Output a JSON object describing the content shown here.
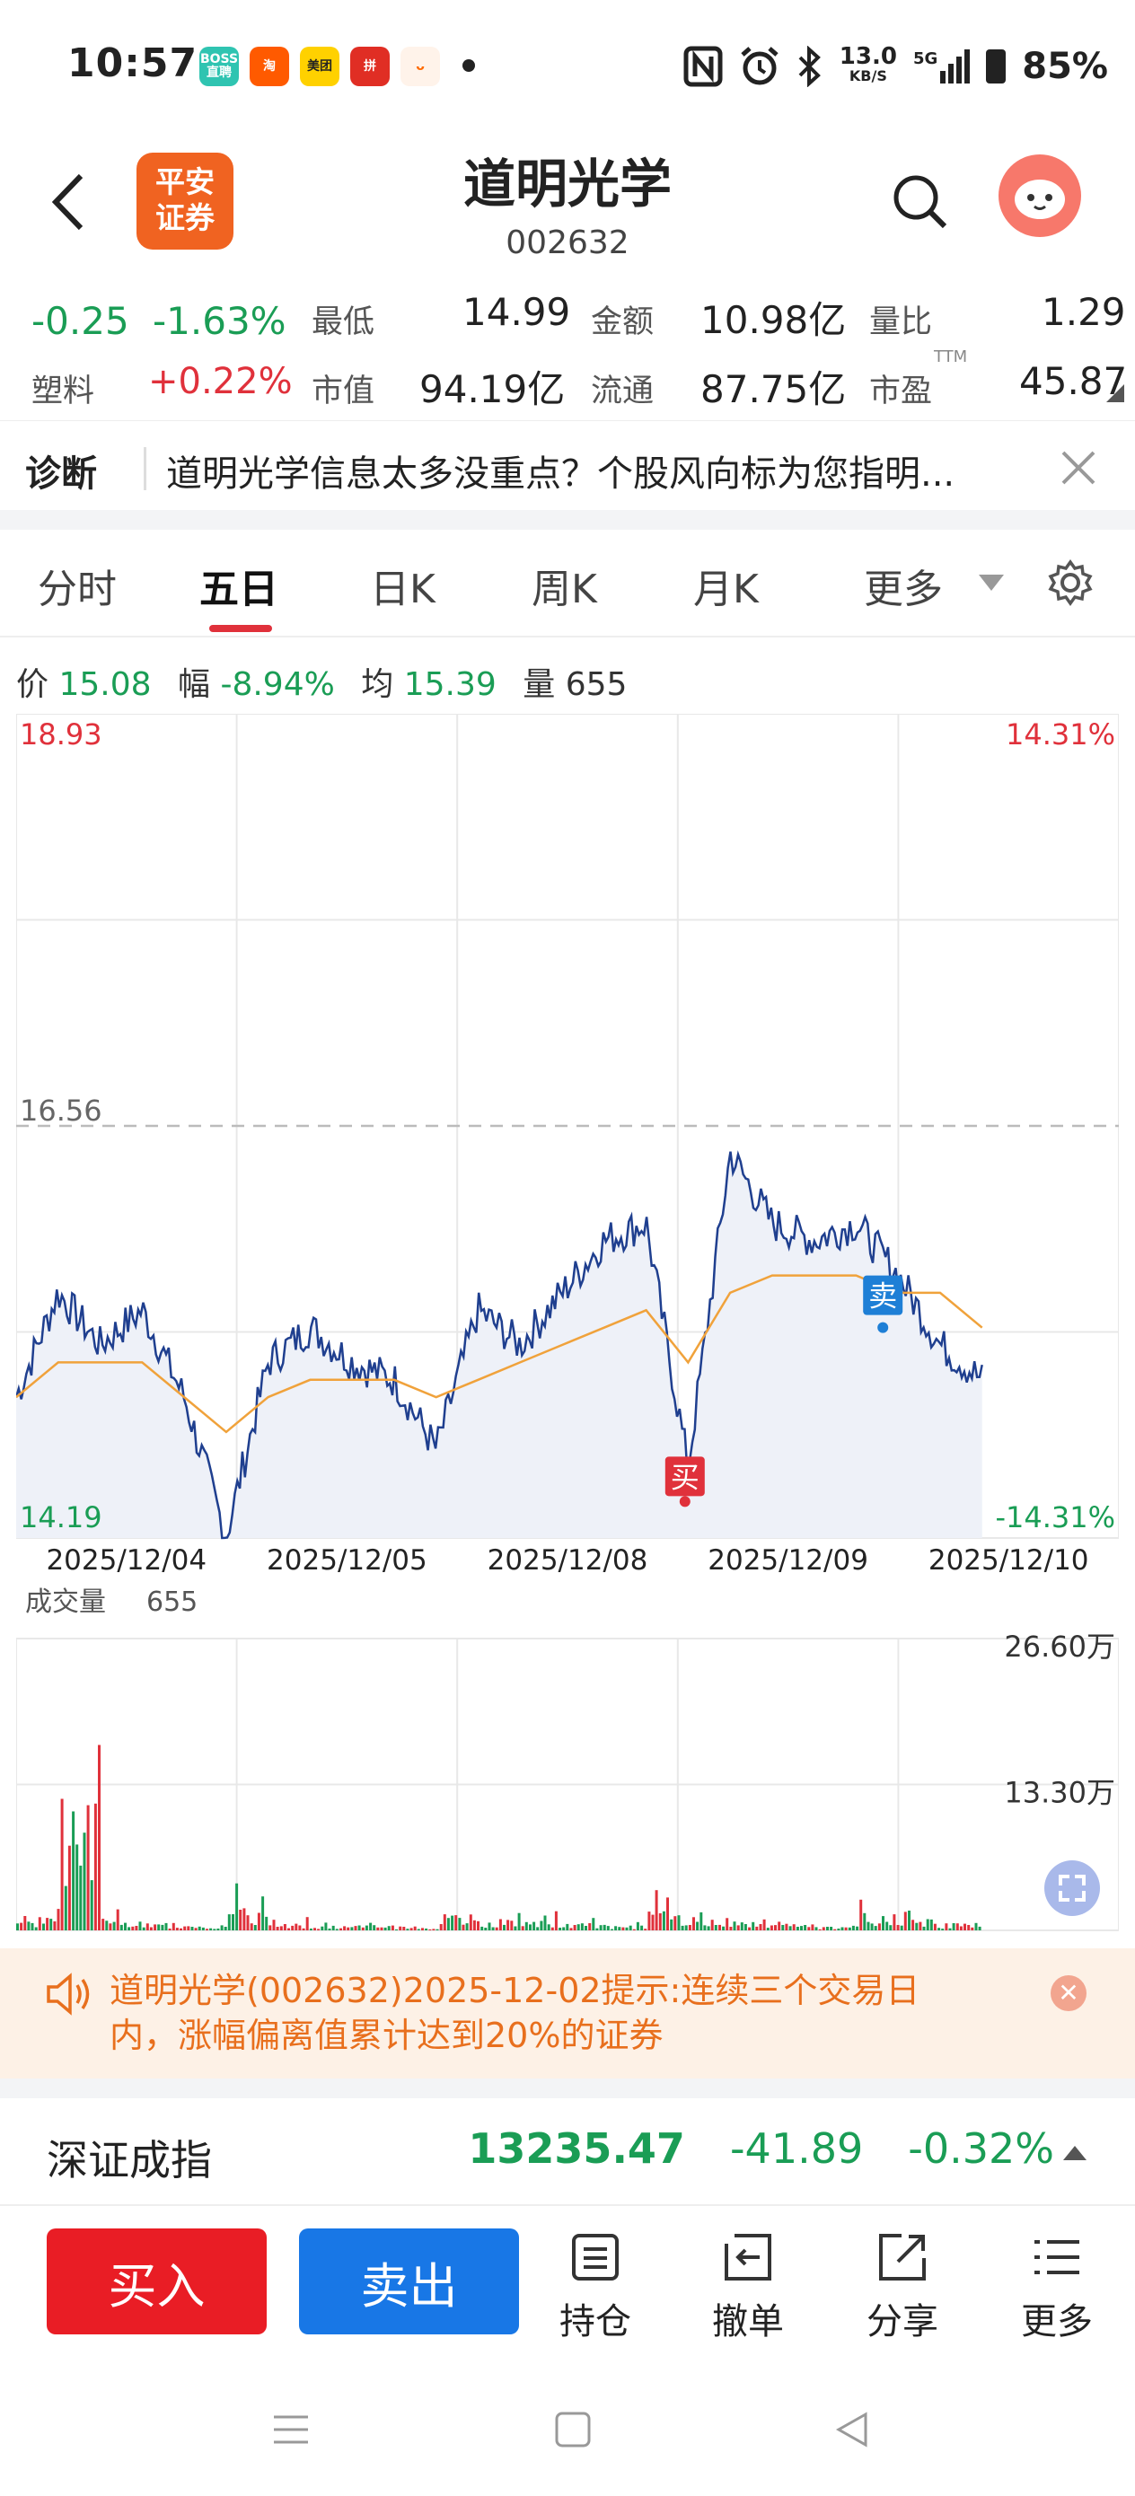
{
  "status_bar": {
    "time": "10:57",
    "apps": [
      {
        "label": "BOSS\n直聘",
        "color": "#2fc4b1",
        "fg": "#fff"
      },
      {
        "label": "淘",
        "color": "#ff5a00",
        "fg": "#fff"
      },
      {
        "label": "美团",
        "color": "#ffd100",
        "fg": "#222"
      },
      {
        "label": "拼",
        "color": "#e02e24",
        "fg": "#fff"
      },
      {
        "label": "ᴗ",
        "color": "#fff3ea",
        "fg": "#ff6a00"
      }
    ],
    "net_speed": "13.0",
    "net_unit": "KB/S",
    "signal": "5G",
    "battery": "85%"
  },
  "header": {
    "logo_text": "平安证券",
    "title": "道明光学",
    "code": "002632"
  },
  "quote": {
    "change": "-0.25",
    "change_pct": "-1.63%",
    "low_label": "最低",
    "low": "14.99",
    "amount_label": "金额",
    "amount": "10.98亿",
    "vol_ratio_label": "量比",
    "vol_ratio": "1.29",
    "sector_label": "塑料",
    "sector_pct": "+0.22%",
    "mktcap_label": "市值",
    "mktcap": "94.19亿",
    "float_label": "流通",
    "float": "87.75亿",
    "pe_label": "市盈",
    "pe_sup": "TTM",
    "pe": "45.87"
  },
  "diagnosis": {
    "label": "诊断",
    "text": "道明光学信息太多没重点？个股风向标为您指明..."
  },
  "tabs": [
    "分时",
    "五日",
    "日K",
    "周K",
    "月K",
    "更多"
  ],
  "info_line": {
    "price_label": "价",
    "price": "15.08",
    "amp_label": "幅",
    "amp": "-8.94%",
    "avg_label": "均",
    "avg": "15.39",
    "vol_label": "量",
    "vol": "655"
  },
  "chart_data": [
    {
      "type": "line",
      "title": "",
      "x": [
        "2025/12/04",
        "2025/12/05",
        "2025/12/08",
        "2025/12/09",
        "2025/12/10"
      ],
      "ylim": [
        14.19,
        18.93
      ],
      "y_ref": "16.56",
      "y_top_label": "18.93",
      "y_bottom_label": "14.19",
      "pct_top": "14.31%",
      "pct_bottom": "-14.31%",
      "series": [
        {
          "values": [
            15.0,
            15.6,
            15.3,
            15.5,
            15.0,
            14.2,
            15.2,
            15.4,
            15.2,
            15.1,
            14.7,
            15.5,
            15.3,
            15.6,
            15.9,
            16.0,
            14.6,
            16.4,
            16.0,
            15.9,
            16.0,
            15.7,
            15.3,
            15.1
          ]
        },
        {
          "values": [
            15.0,
            15.2,
            15.2,
            15.2,
            15.0,
            14.8,
            15.0,
            15.1,
            15.1,
            15.1,
            15.0,
            15.1,
            15.2,
            15.3,
            15.4,
            15.5,
            15.2,
            15.6,
            15.7,
            15.7,
            15.7,
            15.6,
            15.6,
            15.4
          ]
        }
      ],
      "markers": [
        {
          "label": "买",
          "date": "2025/12/09",
          "value": 14.4,
          "color": "#e0313b"
        },
        {
          "label": "卖",
          "date": "2025/12/09",
          "value": 15.4,
          "color": "#1e7fd6"
        }
      ]
    },
    {
      "type": "bar",
      "title": "成交量",
      "value_label": "655",
      "ylim": [
        0,
        266000
      ],
      "tick_labels": [
        "26.60万",
        "13.30万"
      ],
      "x": [
        "2025/12/04",
        "2025/12/05",
        "2025/12/08",
        "2025/12/09",
        "2025/12/10"
      ],
      "series": [
        {
          "name": "",
          "values": [
            30000,
            266000,
            20000,
            15000,
            12000,
            45000,
            15000,
            10000,
            12000,
            8000,
            35000,
            25000,
            20000,
            15000,
            12000,
            40000,
            30000,
            18000,
            14000,
            10000,
            35000,
            25000,
            15000,
            10000
          ]
        }
      ]
    }
  ],
  "notice": {
    "text": "道明光学(002632)2025-12-02提示:连续三个交易日内，涨幅偏离值累计达到20%的证券"
  },
  "index_bar": {
    "name": "深证成指",
    "value": "13235.47",
    "change": "-41.89",
    "change_pct": "-0.32%"
  },
  "actions": {
    "buy": "买入",
    "sell": "卖出",
    "items": [
      "持仓",
      "撤单",
      "分享",
      "更多"
    ]
  },
  "colors": {
    "up": "#e0313b",
    "down": "#1a9d55",
    "price_line": "#1f3f8f",
    "avg_line": "#f0a23b"
  }
}
